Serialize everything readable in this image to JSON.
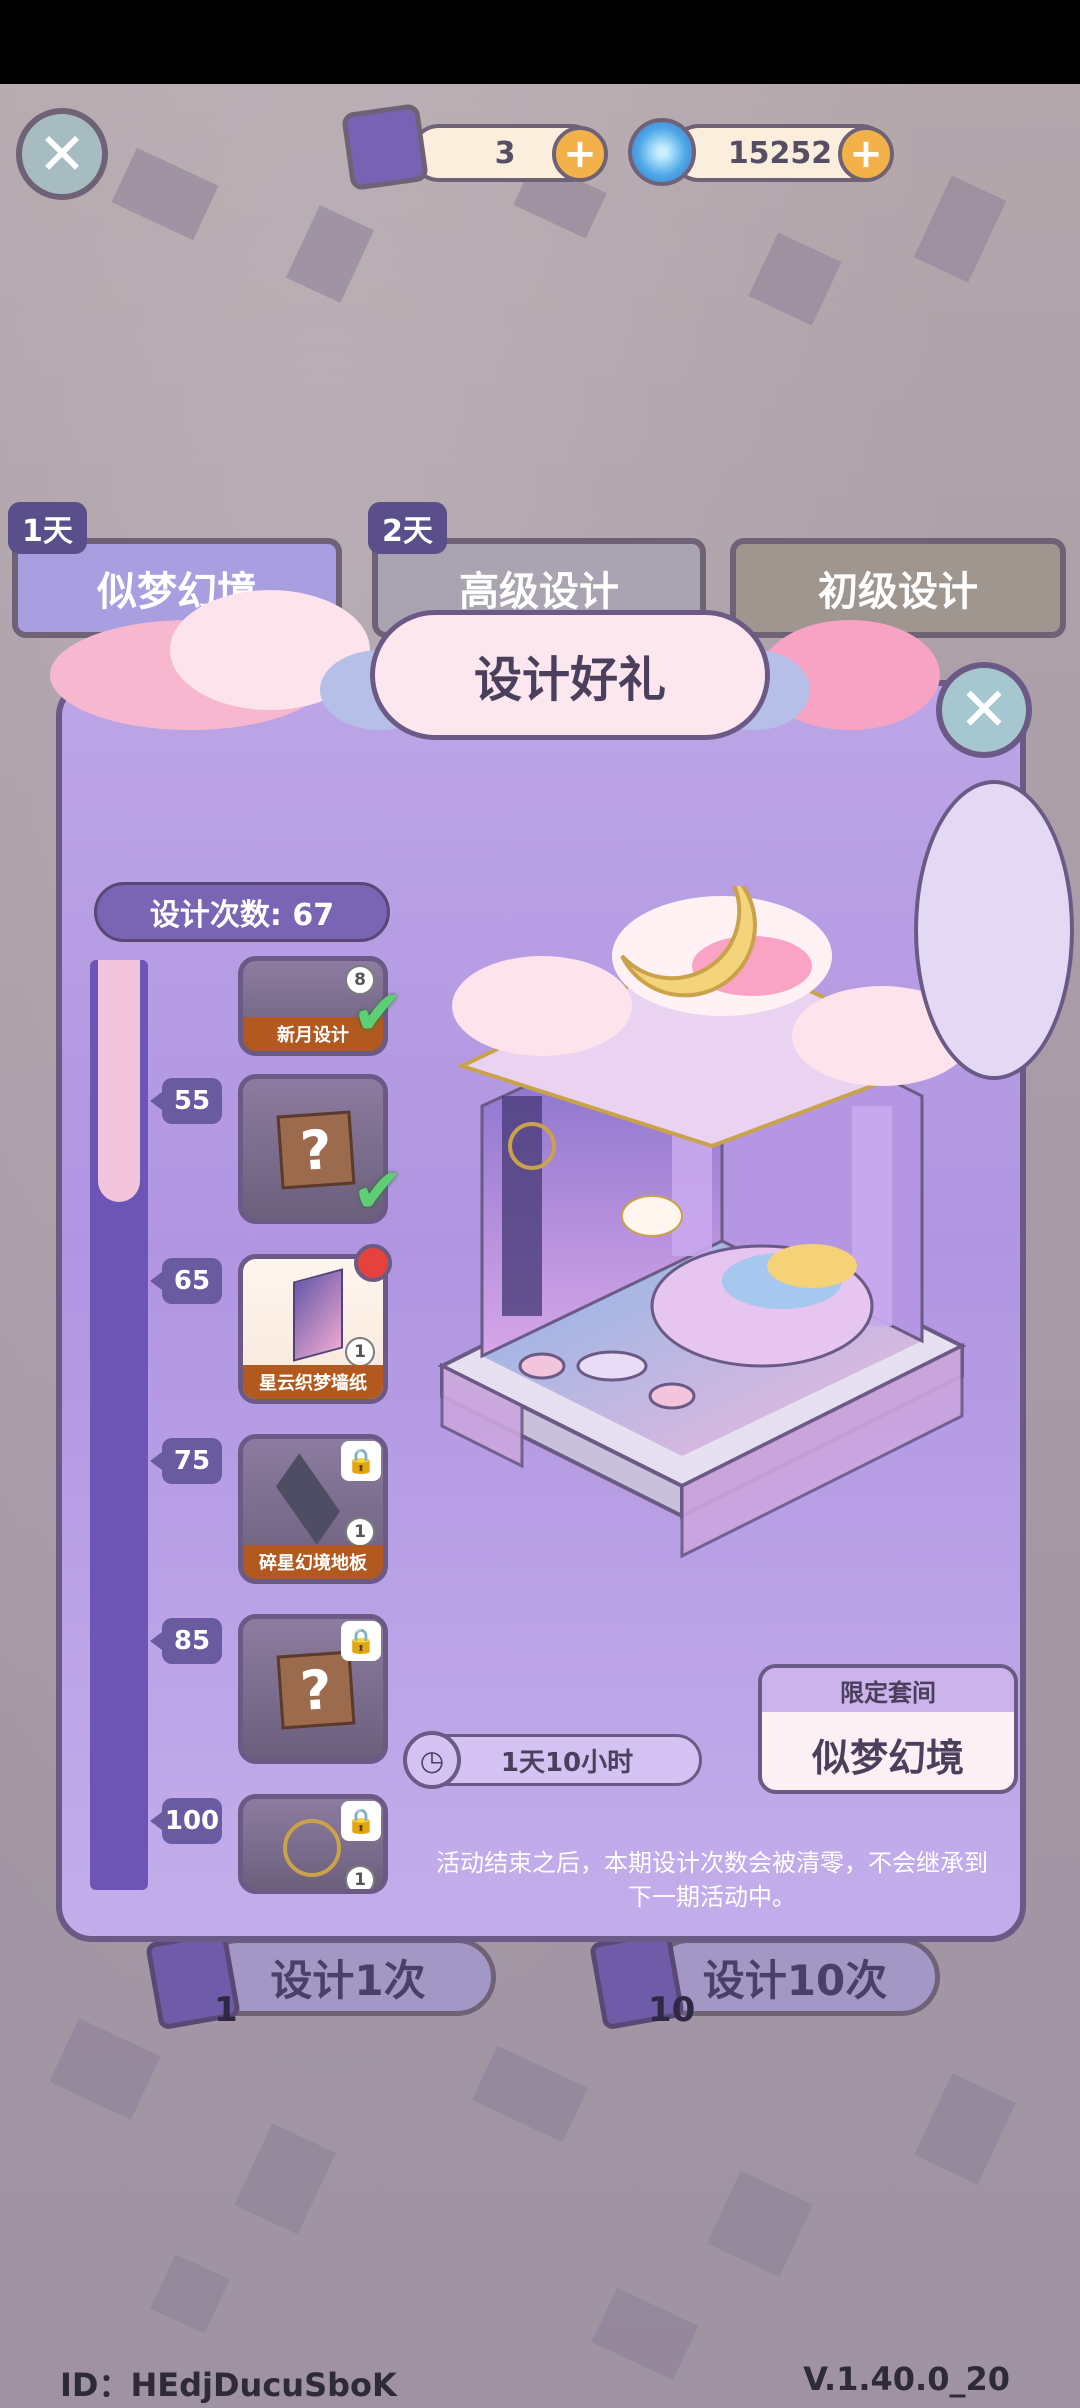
{
  "top_bar": {
    "close_icon": "close-icon",
    "ticket_count": "3",
    "currency_count": "15252"
  },
  "background": {
    "tabs": [
      {
        "day": "1天",
        "label": "似梦幻境"
      },
      {
        "day": "2天",
        "label": "高级设计"
      },
      {
        "day": "",
        "label": "初级设计"
      }
    ],
    "buttons": [
      {
        "label": "设计1次",
        "count": "1"
      },
      {
        "label": "设计10次",
        "count": "10"
      }
    ],
    "id_text": "ID：HEdjDucuSboK",
    "version": "V.1.40.0_20"
  },
  "modal": {
    "title": "设计好礼",
    "design_count": "设计次数: 67",
    "progress": 0.26,
    "milestones": [
      "55",
      "65",
      "75",
      "85",
      "100"
    ],
    "rewards": [
      {
        "name": "新月设计",
        "qty": "8",
        "state": "claimed"
      },
      {
        "name": "",
        "qty": "",
        "state": "claimed"
      },
      {
        "name": "星云织梦墙纸",
        "qty": "1",
        "state": "available"
      },
      {
        "name": "碎星幻境地板",
        "qty": "1",
        "state": "locked"
      },
      {
        "name": "",
        "qty": "",
        "state": "locked"
      },
      {
        "name": "",
        "qty": "1",
        "state": "locked"
      }
    ],
    "timer": "1天10小时",
    "suite_header": "限定套间",
    "suite_name": "似梦幻境",
    "notice": "活动结束之后，本期设计次数会被清零，不会继承到下一期活动中。"
  }
}
